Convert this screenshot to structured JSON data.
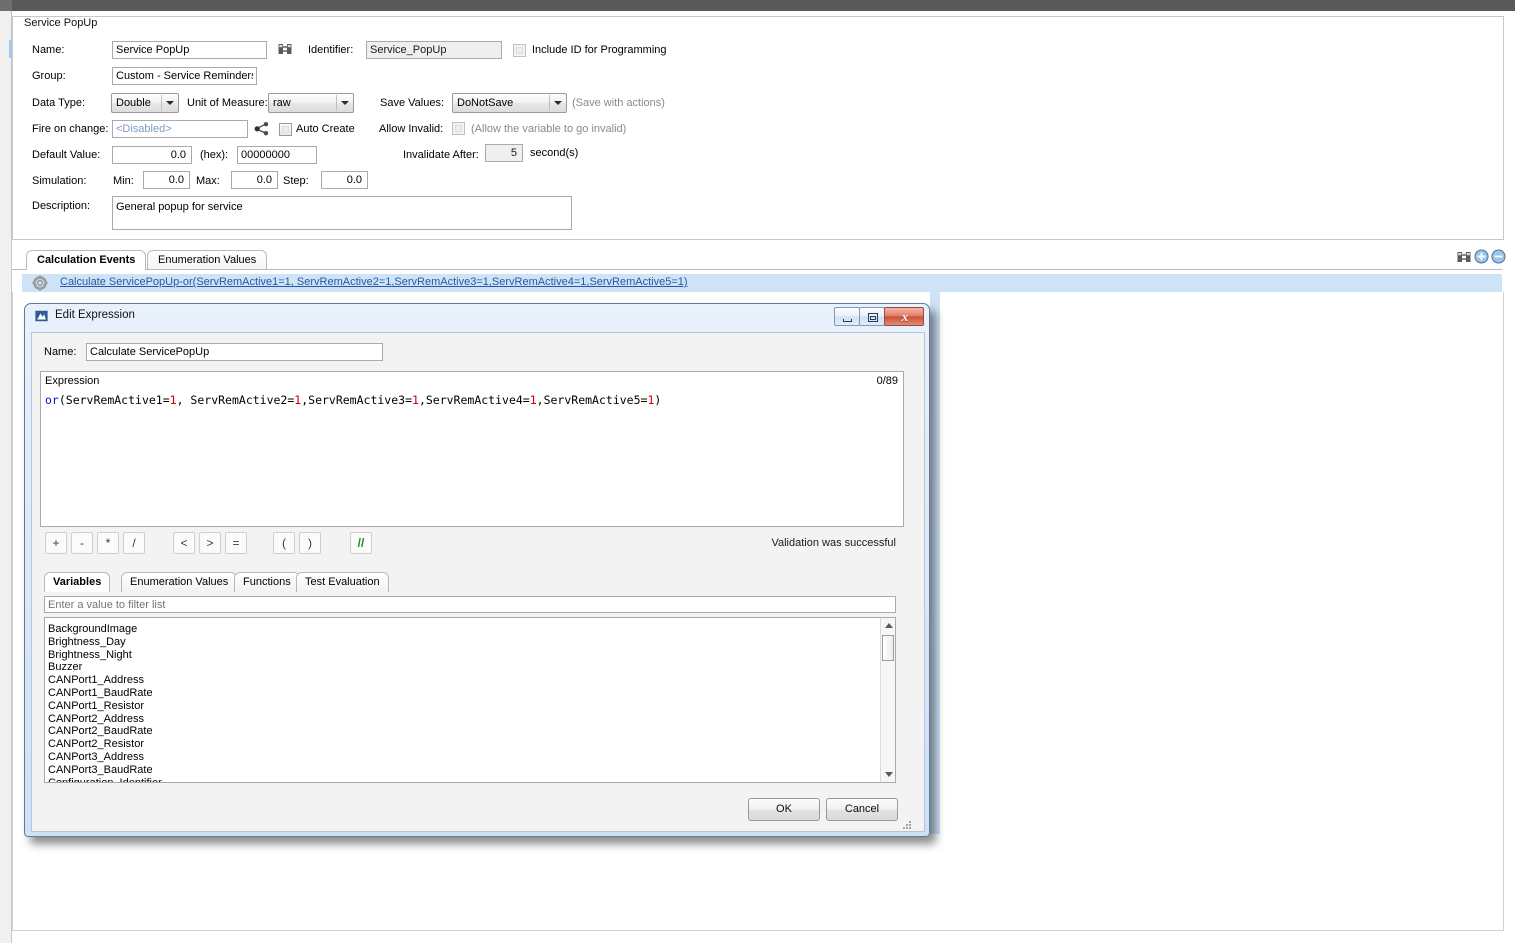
{
  "window": {
    "panel_title": "Service PopUp"
  },
  "form": {
    "name_label": "Name:",
    "name_value": "Service PopUp",
    "find_icon": "binoculars-icon",
    "identifier_label": "Identifier:",
    "identifier_value": "Service_PopUp",
    "include_id_label": "Include ID for Programming",
    "group_label": "Group:",
    "group_value": "Custom - Service Reminders",
    "data_type_label": "Data Type:",
    "data_type_value": "Double",
    "unit_label": "Unit of Measure:",
    "unit_value": "raw",
    "save_values_label": "Save Values:",
    "save_values_value": "DoNotSave",
    "save_with_actions_hint": "(Save with actions)",
    "fire_on_change_label": "Fire on change:",
    "fire_on_change_value": "<Disabled>",
    "share_icon": "share-nodes-icon",
    "auto_create_label": "Auto Create",
    "allow_invalid_label": "Allow Invalid:",
    "allow_invalid_hint": "(Allow the variable to go invalid)",
    "default_value_label": "Default Value:",
    "default_value": "0.0",
    "hex_label": "(hex):",
    "hex_value": "00000000",
    "invalidate_after_label": "Invalidate After:",
    "invalidate_after_value": "5",
    "seconds_label": "second(s)",
    "simulation_label": "Simulation:",
    "min_label": "Min:",
    "min_value": "0.0",
    "max_label": "Max:",
    "max_value": "0.0",
    "step_label": "Step:",
    "step_value": "0.0",
    "description_label": "Description:",
    "description_value": "General popup for service"
  },
  "tabs": {
    "items": [
      {
        "label": "Calculation Events",
        "active": true
      },
      {
        "label": "Enumeration Values",
        "active": false
      }
    ],
    "toolbar_icons": [
      "find-icon",
      "add-icon",
      "remove-icon"
    ]
  },
  "events": {
    "gear_icon": "gear-icon",
    "link_text": "Calculate ServicePopUp-or(ServRemActive1=1, ServRemActive2=1,ServRemActive3=1,ServRemActive4=1,ServRemActive5=1)"
  },
  "dialog": {
    "title": "Edit Expression",
    "app_icon": "application-icon",
    "buttons": {
      "minimize": "minimize-icon",
      "restore": "restore-icon",
      "close": "x"
    },
    "name_label": "Name:",
    "name_value": "Calculate ServicePopUp",
    "expression": {
      "header": "Expression",
      "counter": "0/89",
      "tokens": [
        {
          "text": "or",
          "type": "keyword"
        },
        {
          "text": "(ServRemActive1=",
          "type": "plain"
        },
        {
          "text": "1",
          "type": "number"
        },
        {
          "text": ", ServRemActive2=",
          "type": "plain"
        },
        {
          "text": "1",
          "type": "number"
        },
        {
          "text": ",ServRemActive3=",
          "type": "plain"
        },
        {
          "text": "1",
          "type": "number"
        },
        {
          "text": ",ServRemActive4=",
          "type": "plain"
        },
        {
          "text": "1",
          "type": "number"
        },
        {
          "text": ",ServRemActive5=",
          "type": "plain"
        },
        {
          "text": "1",
          "type": "number"
        },
        {
          "text": ")",
          "type": "plain"
        }
      ]
    },
    "operators": [
      "+",
      "-",
      "*",
      "/",
      "<",
      ">",
      "=",
      "(",
      ")",
      "//"
    ],
    "validation_text": "Validation was successful",
    "inner_tabs": [
      {
        "label": "Variables",
        "active": true
      },
      {
        "label": "Enumeration Values",
        "active": false
      },
      {
        "label": "Functions",
        "active": false
      },
      {
        "label": "Test Evaluation",
        "active": false
      }
    ],
    "filter_placeholder": "Enter a value to filter list",
    "filter_value": "",
    "variables": [
      "BackgroundImage",
      "Brightness_Day",
      "Brightness_Night",
      "Buzzer",
      "CANPort1_Address",
      "CANPort1_BaudRate",
      "CANPort1_Resistor",
      "CANPort2_Address",
      "CANPort2_BaudRate",
      "CANPort2_Resistor",
      "CANPort3_Address",
      "CANPort3_BaudRate",
      "Configuration_Identifier"
    ],
    "ok_label": "OK",
    "cancel_label": "Cancel"
  },
  "colors": {
    "link": "#2558a6",
    "highlight_row": "#cfe3f7",
    "keyword": "#0018c8",
    "number": "#d00000",
    "comment_button": "#1e8a1e"
  }
}
